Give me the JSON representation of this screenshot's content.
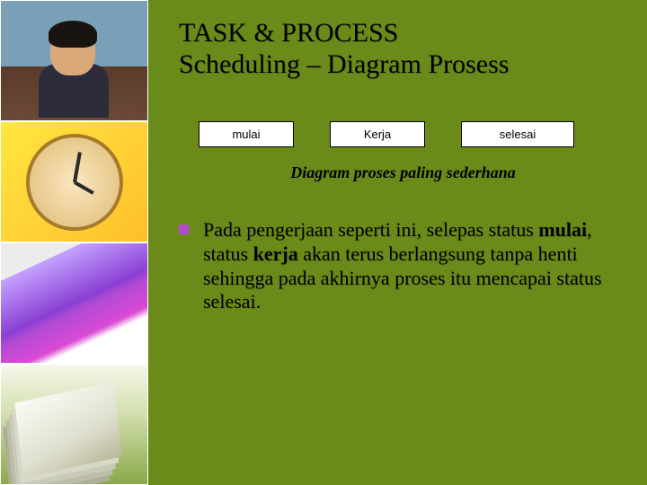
{
  "title": {
    "line1": "TASK & PROCESS",
    "line2": "Scheduling – Diagram Prosess"
  },
  "flow": {
    "box1": "mulai",
    "box2": "Kerja",
    "box3": "selesai"
  },
  "caption": "Diagram proses paling sederhana",
  "bullet": {
    "pre": "Pada pengerjaan seperti ini, selepas status ",
    "bold1": "mulai",
    "mid1": ", status ",
    "bold2": "kerja",
    "post": " akan terus berlangsung tanpa henti sehingga pada akhirnya proses itu mencapai status selesai."
  }
}
